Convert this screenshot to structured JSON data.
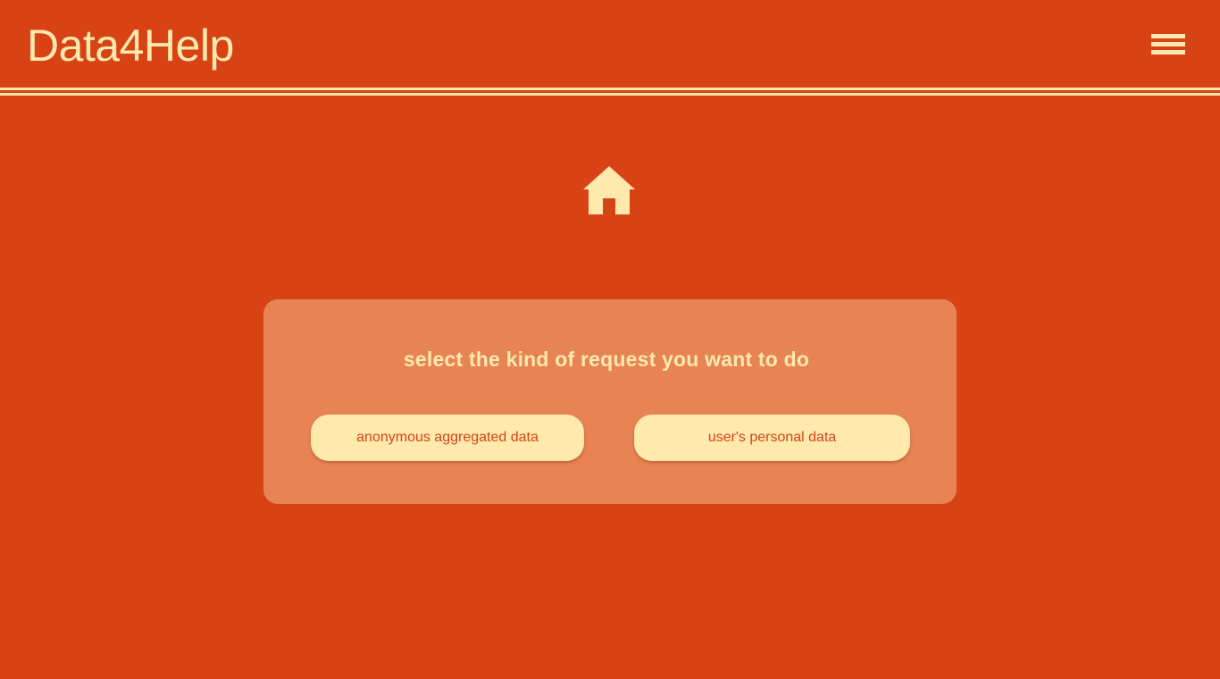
{
  "header": {
    "brand": "Data4Help",
    "menu_icon": "hamburger-menu-icon"
  },
  "main": {
    "home_icon": "home-icon",
    "card": {
      "title": "select the kind of request you want to do",
      "buttons": [
        {
          "label": "anonymous aggregated data"
        },
        {
          "label": "user's personal data"
        }
      ]
    }
  },
  "colors": {
    "background": "#d84315",
    "accent": "#ffe9ad",
    "card": "#e88354"
  }
}
